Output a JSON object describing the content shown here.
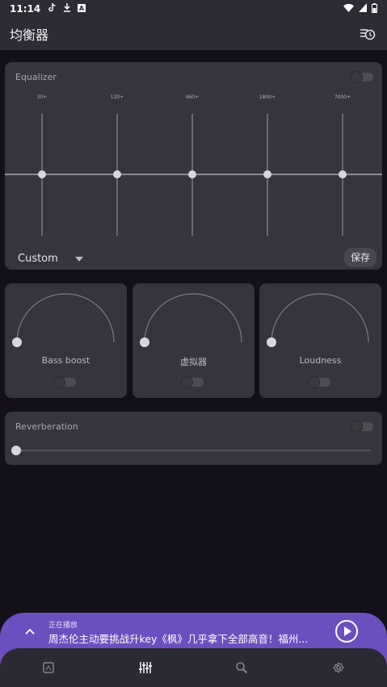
{
  "status_bar": {
    "time": "11:14",
    "icons": [
      "tiktok-icon",
      "download-icon",
      "notification-a-icon",
      "wifi-icon",
      "signal-icon",
      "battery-icon"
    ]
  },
  "app_bar": {
    "title": "均衡器",
    "action_icon": "preset-timer-icon"
  },
  "equalizer": {
    "title": "Equalizer",
    "enabled": false,
    "bands": [
      {
        "freq": "30+",
        "level": 0
      },
      {
        "freq": "120+",
        "level": 0
      },
      {
        "freq": "460+",
        "level": 0
      },
      {
        "freq": "1800+",
        "level": 0
      },
      {
        "freq": "7000+",
        "level": 0
      }
    ],
    "preset": "Custom",
    "save_label": "保存"
  },
  "effects": [
    {
      "label": "Bass boost",
      "enabled": false,
      "level": 0
    },
    {
      "label": "虚拟器",
      "enabled": false,
      "level": 0
    },
    {
      "label": "Loudness",
      "enabled": false,
      "level": 0
    }
  ],
  "reverberation": {
    "title": "Reverberation",
    "enabled": false,
    "level": 0
  },
  "now_playing": {
    "label": "正在播放",
    "title": "周杰伦主动要挑战升key《枫》几乎拿下全部高音！福州..."
  },
  "bottom_nav": {
    "items": [
      "library-icon",
      "equalizer-icon",
      "search-icon",
      "settings-icon"
    ],
    "active": 1
  },
  "colors": {
    "background": "#13101a",
    "card": "#36343c",
    "accent": "#6b4fbe"
  }
}
